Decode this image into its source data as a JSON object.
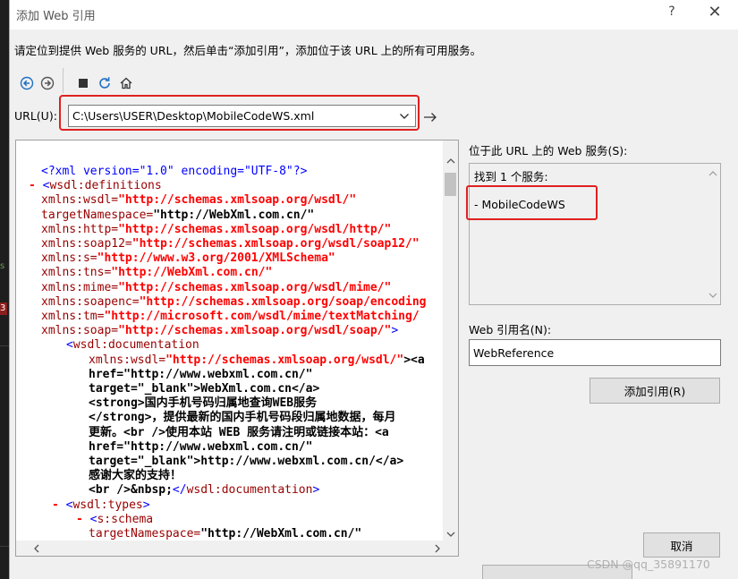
{
  "dialog": {
    "title": "添加 Web 引用",
    "help_glyph": "?",
    "close_glyph": "✕",
    "instruction": "请定位到提供 Web 服务的 URL，然后单击“添加引用”，添加位于该 URL 上的所有可用服务。"
  },
  "toolbar": {
    "buttons": [
      "back",
      "forward",
      "stop",
      "refresh",
      "home"
    ]
  },
  "url": {
    "label": "URL(U):",
    "value": "C:\\Users\\USER\\Desktop\\MobileCodeWS.xml"
  },
  "xml_view": {
    "lines": [
      {
        "parts": [
          {
            "t": "<?xml version=\"1.0\" encoding=\"UTF-8\"?>",
            "c": "c-blue"
          }
        ]
      },
      {
        "parts": [
          {
            "t": "- ",
            "c": "c-red"
          },
          {
            "t": "<",
            "c": "c-blue"
          },
          {
            "t": "wsdl:definitions",
            "c": "c-maroon"
          }
        ]
      },
      {
        "parts": [
          {
            "t": "xmlns:wsdl=",
            "c": "c-maroon"
          },
          {
            "t": "\"http://schemas.xmlsoap.org/wsdl/\"",
            "c": "c-red"
          }
        ]
      },
      {
        "parts": [
          {
            "t": "targetNamespace=",
            "c": "c-maroon"
          },
          {
            "t": "\"http://WebXml.com.cn/\"",
            "c": "c-black"
          }
        ]
      },
      {
        "parts": [
          {
            "t": "xmlns:http=",
            "c": "c-maroon"
          },
          {
            "t": "\"http://schemas.xmlsoap.org/wsdl/http/\"",
            "c": "c-red"
          }
        ]
      },
      {
        "parts": [
          {
            "t": "xmlns:soap12=",
            "c": "c-maroon"
          },
          {
            "t": "\"http://schemas.xmlsoap.org/wsdl/soap12/\"",
            "c": "c-red"
          }
        ]
      },
      {
        "parts": [
          {
            "t": "xmlns:s=",
            "c": "c-maroon"
          },
          {
            "t": "\"http://www.w3.org/2001/XMLSchema\"",
            "c": "c-red"
          }
        ]
      },
      {
        "parts": [
          {
            "t": "xmlns:tns=",
            "c": "c-maroon"
          },
          {
            "t": "\"http://WebXml.com.cn/\"",
            "c": "c-red"
          }
        ]
      },
      {
        "parts": [
          {
            "t": "xmlns:mime=",
            "c": "c-maroon"
          },
          {
            "t": "\"http://schemas.xmlsoap.org/wsdl/mime/\"",
            "c": "c-red"
          }
        ]
      },
      {
        "parts": [
          {
            "t": "xmlns:soapenc=",
            "c": "c-maroon"
          },
          {
            "t": "\"http://schemas.xmlsoap.org/soap/encoding",
            "c": "c-red"
          }
        ]
      },
      {
        "parts": [
          {
            "t": "xmlns:tm=",
            "c": "c-maroon"
          },
          {
            "t": "\"http://microsoft.com/wsdl/mime/textMatching/",
            "c": "c-red"
          }
        ]
      },
      {
        "parts": [
          {
            "t": "xmlns:soap=",
            "c": "c-maroon"
          },
          {
            "t": "\"http://schemas.xmlsoap.org/wsdl/soap/\"",
            "c": "c-red"
          },
          {
            "t": ">",
            "c": "c-blue"
          }
        ]
      },
      {
        "parts": [
          {
            "t": "<",
            "c": "c-blue"
          },
          {
            "t": "wsdl:documentation",
            "c": "c-maroon"
          }
        ]
      },
      {
        "parts": [
          {
            "t": "xmlns:wsdl=",
            "c": "c-maroon"
          },
          {
            "t": "\"http://schemas.xmlsoap.org/wsdl/\"",
            "c": "c-red"
          },
          {
            "t": "><a",
            "c": "c-black"
          }
        ]
      },
      {
        "parts": [
          {
            "t": "href=\"http://www.webxml.com.cn/\"",
            "c": "c-black"
          }
        ]
      },
      {
        "parts": [
          {
            "t": "target=\"_blank\">WebXml.com.cn</a>",
            "c": "c-black"
          }
        ]
      },
      {
        "parts": [
          {
            "t": "<strong>国内手机号码归属地查询WEB服务",
            "c": "c-black"
          }
        ]
      },
      {
        "parts": [
          {
            "t": "</strong>，提供最新的国内手机号码段归属地数据，每月",
            "c": "c-black"
          }
        ]
      },
      {
        "parts": [
          {
            "t": "更新。<br />使用本站 WEB 服务请注明或链接本站：<a",
            "c": "c-black"
          }
        ]
      },
      {
        "parts": [
          {
            "t": "href=\"http://www.webxml.com.cn/\"",
            "c": "c-black"
          }
        ]
      },
      {
        "parts": [
          {
            "t": "target=\"_blank\">http://www.webxml.com.cn/</a>",
            "c": "c-black"
          }
        ]
      },
      {
        "parts": [
          {
            "t": "感谢大家的支持！",
            "c": "c-black"
          }
        ]
      },
      {
        "parts": [
          {
            "t": "<br />&nbsp;",
            "c": "c-black"
          },
          {
            "t": "</",
            "c": "c-blue"
          },
          {
            "t": "wsdl:documentation",
            "c": "c-maroon"
          },
          {
            "t": ">",
            "c": "c-blue"
          }
        ]
      },
      {
        "parts": [
          {
            "t": "- ",
            "c": "c-red"
          },
          {
            "t": "<",
            "c": "c-blue"
          },
          {
            "t": "wsdl:types",
            "c": "c-maroon"
          },
          {
            "t": ">",
            "c": "c-blue"
          }
        ]
      },
      {
        "parts": [
          {
            "t": "- ",
            "c": "c-red"
          },
          {
            "t": "<",
            "c": "c-blue"
          },
          {
            "t": "s:schema",
            "c": "c-maroon"
          }
        ]
      },
      {
        "parts": [
          {
            "t": "targetNamespace=",
            "c": "c-maroon"
          },
          {
            "t": "\"http://WebXml.com.cn/\"",
            "c": "c-black"
          }
        ]
      }
    ]
  },
  "services": {
    "label": "位于此 URL 上的 Web 服务(S):",
    "found_text": "找到 1 个服务:",
    "items": [
      "- MobileCodeWS"
    ]
  },
  "reference": {
    "label": "Web 引用名(N):",
    "value": "WebReference"
  },
  "buttons": {
    "add_reference": "添加引用(R)",
    "cancel": "取消"
  },
  "watermark": "CSDN @qq_35891170",
  "colors": {
    "highlight_box": "#e02020",
    "xml_tag": "#990000",
    "xml_punct": "#0000ff",
    "xml_value": "#ff0000"
  }
}
